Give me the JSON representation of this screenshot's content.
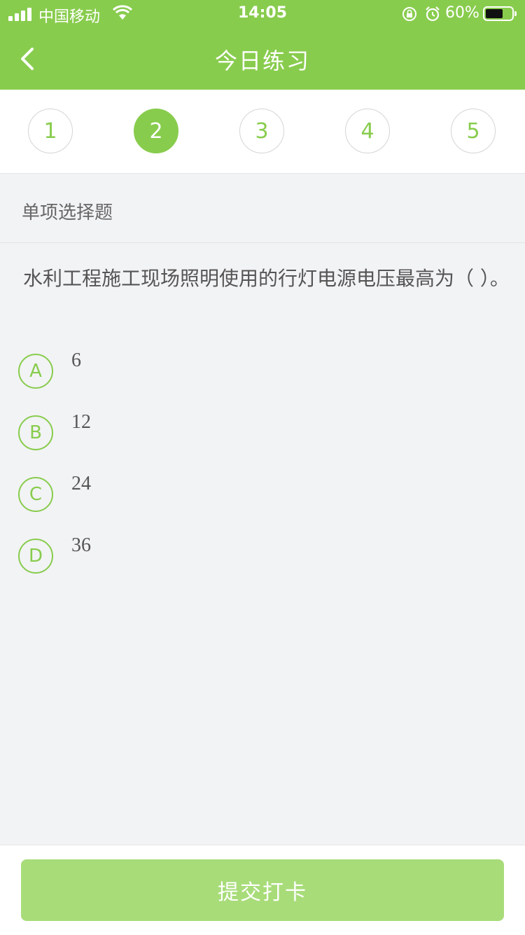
{
  "status_bar": {
    "carrier": "中国移动",
    "time": "14:05",
    "battery_percent": "60%",
    "icons": [
      "signal-icon",
      "wifi-icon",
      "orientation-lock-icon",
      "alarm-icon",
      "battery-icon"
    ]
  },
  "header": {
    "title": "今日练习",
    "back_icon": "chevron-left-icon"
  },
  "stepper": {
    "items": [
      "1",
      "2",
      "3",
      "4",
      "5"
    ],
    "active_index": 1
  },
  "question": {
    "type": "单项选择题",
    "text": "水利工程施工现场照明使用的行灯电源电压最高为（ ）。",
    "options": [
      {
        "letter": "A",
        "text": "6"
      },
      {
        "letter": "B",
        "text": "12"
      },
      {
        "letter": "C",
        "text": "24"
      },
      {
        "letter": "D",
        "text": "36"
      }
    ]
  },
  "footer": {
    "submit_label": "提交打卡"
  },
  "colors": {
    "brand_green": "#88cc4d",
    "button_green_disabled": "#a8dc79",
    "background": "#f2f3f5"
  }
}
